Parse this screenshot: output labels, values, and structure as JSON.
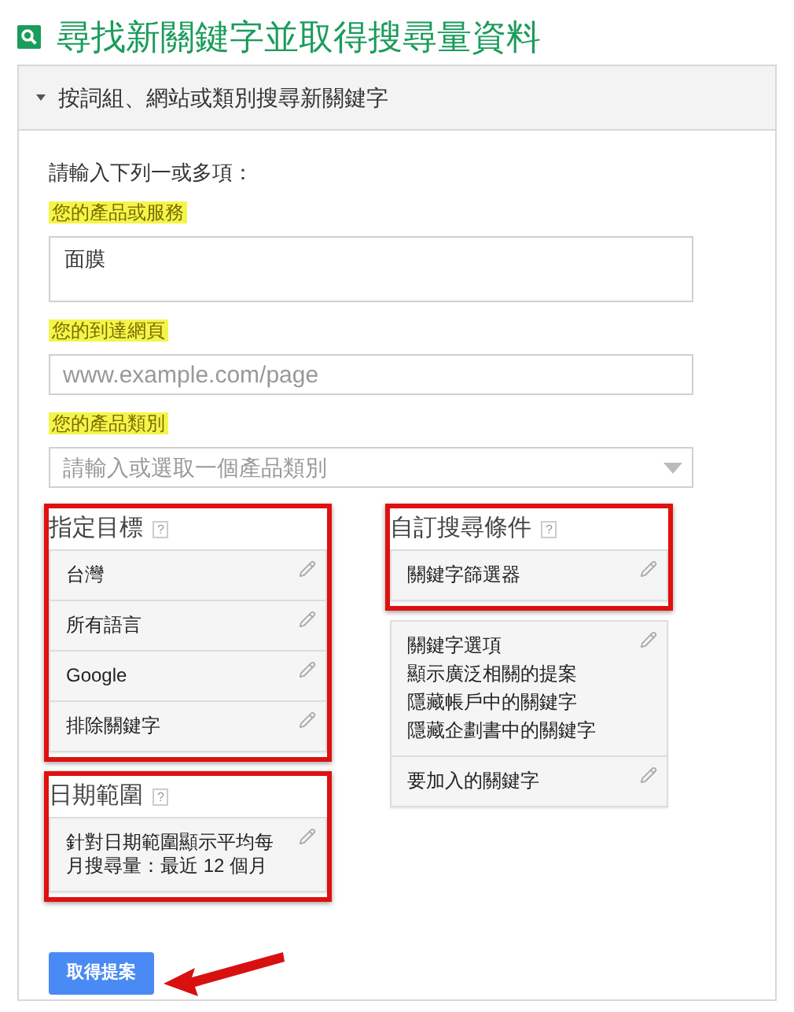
{
  "title": "尋找新關鍵字並取得搜尋量資料",
  "section": {
    "label": "按詞組、網站或類別搜尋新關鍵字",
    "expanded": true
  },
  "intro": "請輸入下列一或多項：",
  "fields": [
    {
      "label": "您的產品或服務",
      "highlighted": true,
      "kind": "textarea",
      "value": "面膜"
    },
    {
      "label": "您的到達網頁",
      "highlighted": true,
      "kind": "text",
      "placeholder": "www.example.com/page"
    },
    {
      "label": "您的產品類別",
      "highlighted": true,
      "kind": "select",
      "placeholder": "請輸入或選取一個產品類別"
    }
  ],
  "left_groups": [
    {
      "heading": "指定目標",
      "help": "?",
      "highlighted": true,
      "cards": [
        {
          "lines": [
            "台灣"
          ]
        },
        {
          "lines": [
            "所有語言"
          ]
        },
        {
          "lines": [
            "Google"
          ]
        },
        {
          "lines": [
            "排除關鍵字"
          ]
        }
      ]
    },
    {
      "heading": "日期範圍",
      "help": "?",
      "highlighted": true,
      "cards": [
        {
          "lines": [
            "針對日期範圍顯示平均每月搜尋量：最近 12 個月"
          ]
        }
      ]
    }
  ],
  "right_groups": [
    {
      "heading": "自訂搜尋條件",
      "help": "?",
      "highlighted": true,
      "cards": [
        {
          "lines": [
            "關鍵字篩選器"
          ]
        }
      ]
    },
    {
      "highlighted": false,
      "cards": [
        {
          "lines": [
            "關鍵字選項",
            "顯示廣泛相關的提案",
            "隱藏帳戶中的關鍵字",
            "隱藏企劃書中的關鍵字"
          ]
        },
        {
          "lines": [
            "要加入的關鍵字"
          ]
        }
      ]
    }
  ],
  "button": {
    "label": "取得提案",
    "annotated": true
  }
}
